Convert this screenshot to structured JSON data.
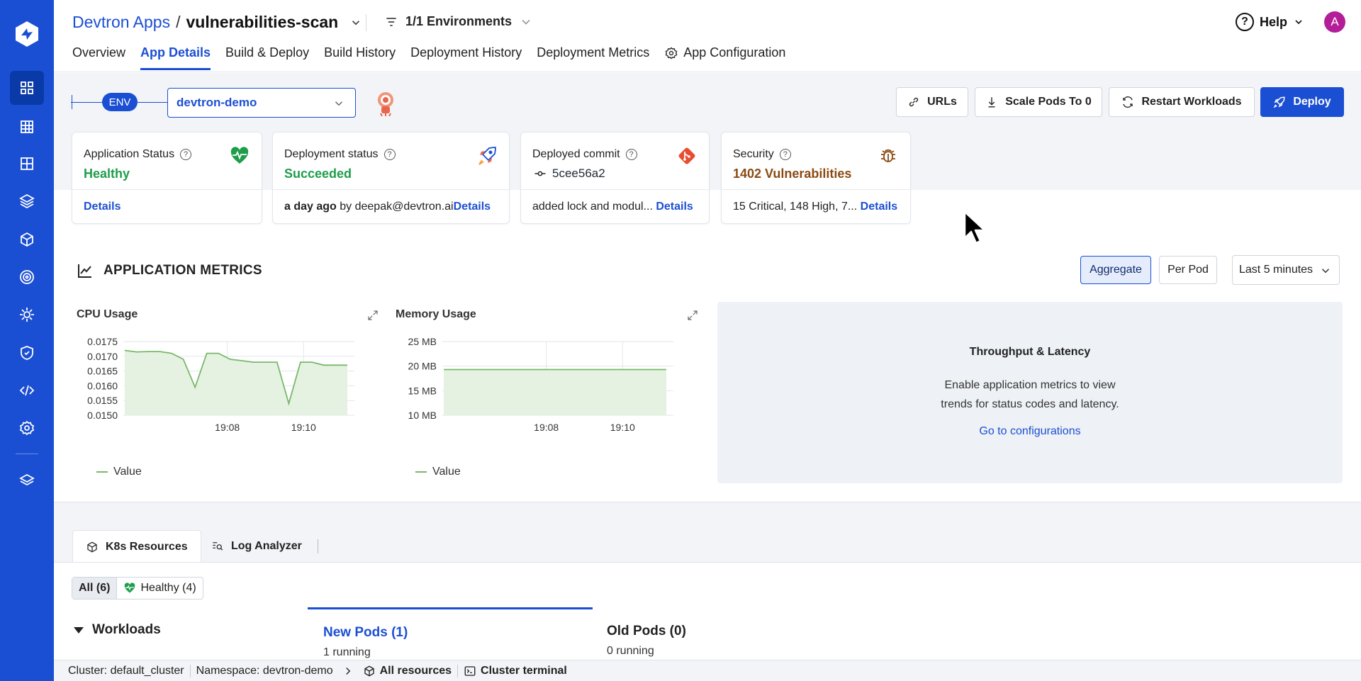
{
  "rail": {
    "items": [
      "apps-icon",
      "app-groups-icon",
      "resource-browser-icon",
      "charts-icon",
      "cube-icon",
      "deployment-icon",
      "bulk-edit-icon",
      "security-icon",
      "code-icon",
      "settings-icon",
      "stack-icon"
    ]
  },
  "header": {
    "org": "Devtron Apps",
    "separator": "/",
    "app_name": "vulnerabilities-scan",
    "env_filter": "1/1 Environments",
    "help": "Help",
    "avatar": "A",
    "tabs": [
      "Overview",
      "App Details",
      "Build & Deploy",
      "Build History",
      "Deployment History",
      "Deployment Metrics",
      "App Configuration"
    ],
    "active_tab": "App Details"
  },
  "env": {
    "pill": "ENV",
    "selected": "devtron-demo"
  },
  "actions": {
    "urls": "URLs",
    "scale": "Scale Pods To 0",
    "restart": "Restart Workloads",
    "deploy": "Deploy"
  },
  "cards": {
    "app_status": {
      "title": "Application Status",
      "value": "Healthy",
      "link": "Details"
    },
    "deploy_status": {
      "title": "Deployment status",
      "value": "Succeeded",
      "time": "a day ago",
      "by": " by deepak@devtron.ai",
      "link": "Details"
    },
    "commit": {
      "title": "Deployed commit",
      "value": "5cee56a2",
      "message": "added lock and modul...",
      "link": "Details"
    },
    "security": {
      "title": "Security",
      "value": "1402 Vulnerabilities",
      "summary": "15 Critical, 148 High, 7...",
      "link": "Details"
    }
  },
  "metrics": {
    "title": "APPLICATION METRICS",
    "aggregate": "Aggregate",
    "per_pod": "Per Pod",
    "range": "Last 5 minutes",
    "legend": "Value",
    "throughput": {
      "title": "Throughput & Latency",
      "line1": "Enable application metrics to view",
      "line2": "trends for status codes and latency.",
      "link": "Go to configurations"
    }
  },
  "chart_data": [
    {
      "type": "area",
      "title": "CPU Usage",
      "x_ticks": [
        "19:08",
        "19:10"
      ],
      "y_ticks": [
        "0.0175",
        "0.0170",
        "0.0165",
        "0.0160",
        "0.0155",
        "0.0150"
      ],
      "ylim": [
        0.015,
        0.0175
      ],
      "series": [
        {
          "name": "Value",
          "values": [
            0.0172,
            0.01715,
            0.01716,
            0.01716,
            0.0171,
            0.0169,
            0.01595,
            0.0171,
            0.0171,
            0.0169,
            0.01685,
            0.0168,
            0.0168,
            0.0168,
            0.0154,
            0.0168,
            0.0168,
            0.0167,
            0.0167,
            0.0167
          ]
        }
      ]
    },
    {
      "type": "area",
      "title": "Memory Usage",
      "x_ticks": [
        "19:08",
        "19:10"
      ],
      "y_ticks": [
        "25 MB",
        "20 MB",
        "15 MB",
        "10 MB"
      ],
      "ylim": [
        10,
        25
      ],
      "series": [
        {
          "name": "Value",
          "values": [
            19.3,
            19.3,
            19.3,
            19.3,
            19.3,
            19.3,
            19.3,
            19.3,
            19.3,
            19.3
          ]
        }
      ]
    }
  ],
  "lower": {
    "tabs": [
      "K8s Resources",
      "Log Analyzer"
    ],
    "filter_all": "All (6)",
    "filter_healthy": "Healthy (4)",
    "workloads": "Workloads",
    "new_pods": "New Pods (1)",
    "new_pods_sub": "1 running",
    "old_pods": "Old Pods (0)",
    "old_pods_sub": "0 running"
  },
  "footer": {
    "cluster": "Cluster: default_cluster",
    "namespace": "Namespace: devtron-demo",
    "all_resources": "All resources",
    "terminal": "Cluster terminal"
  },
  "colors": {
    "brand": "#1b4fd3",
    "healthy": "#1e9e4b",
    "vuln": "#8a4a12",
    "series": "#78b86a"
  }
}
